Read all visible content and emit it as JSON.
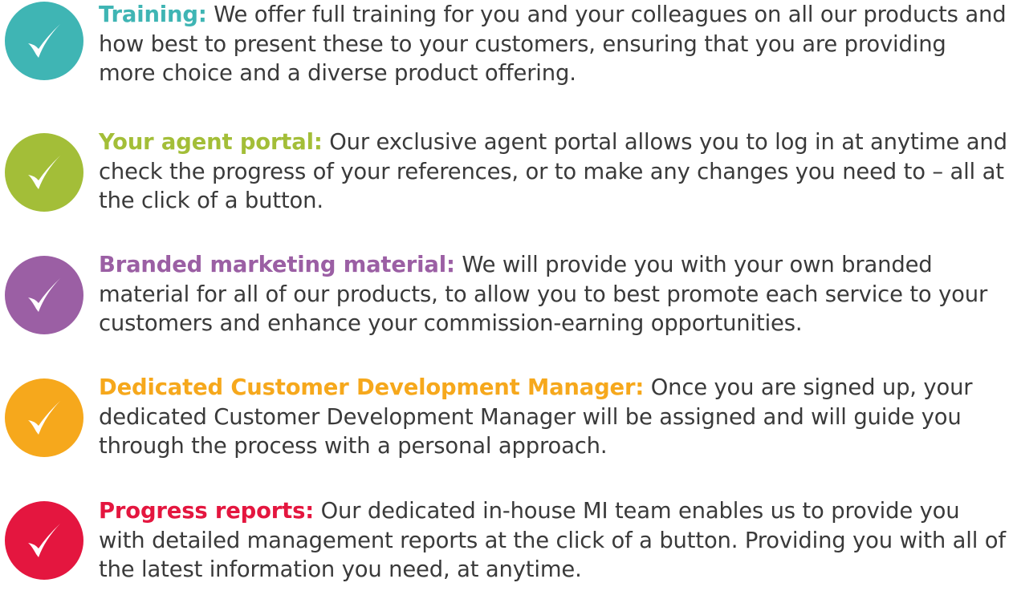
{
  "features": [
    {
      "heading": "Training:",
      "body": " We offer full training for you and your colleagues on all our products and how best to present these to your customers, ensuring that you are providing more choice and a diverse product offering.",
      "color": "#3fb5b4",
      "icon": "check-icon"
    },
    {
      "heading": "Your agent portal:",
      "body": " Our exclusive agent portal allows you to log in at anytime and check the progress of your references, or to make any changes you need to – all at the click of a button.",
      "color": "#a3be38",
      "icon": "check-icon"
    },
    {
      "heading": "Branded marketing material:",
      "body": " We will provide you with your own branded material for all of our products, to allow you to best promote each service to your customers and enhance your commission-earning opportunities.",
      "color": "#9b5fa4",
      "icon": "check-icon"
    },
    {
      "heading": "Dedicated Customer Development Manager:",
      "body": " Once you are signed up, your dedicated Customer Development Manager will be assigned and will guide you through the process with a personal approach.",
      "color": "#f6a81c",
      "icon": "check-icon"
    },
    {
      "heading": "Progress reports:",
      "body": " Our dedicated in-house MI team enables us to provide you with detailed management reports at the click of a button. Providing you with all of the latest information you need, at anytime.",
      "color": "#e4163f",
      "icon": "check-icon"
    }
  ]
}
